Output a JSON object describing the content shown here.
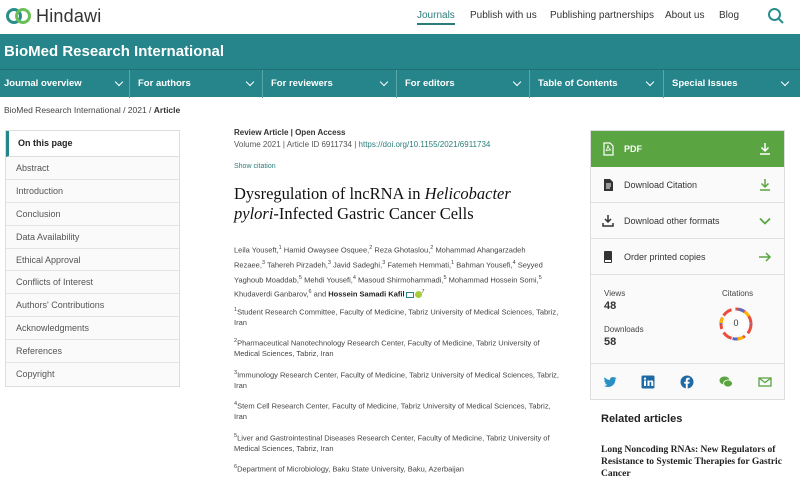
{
  "brand": {
    "name": "Hindawi"
  },
  "top_nav": [
    "Journals",
    "Publish with us",
    "Publishing partnerships",
    "About us",
    "Blog"
  ],
  "journal_title": "BioMed Research International",
  "sub_nav": [
    "Journal overview",
    "For authors",
    "For reviewers",
    "For editors",
    "Table of Contents",
    "Special Issues"
  ],
  "breadcrumb": {
    "path": "BioMed Research International / 2021 / ",
    "current": "Article"
  },
  "sidebar": {
    "heading": "On this page",
    "items": [
      "Abstract",
      "Introduction",
      "Conclusion",
      "Data Availability",
      "Ethical Approval",
      "Conflicts of Interest",
      "Authors' Contributions",
      "Acknowledgments",
      "References",
      "Copyright"
    ]
  },
  "article": {
    "type": "Review Article | Open Access",
    "meta": "Volume 2021 | Article ID 6911734 | ",
    "doi": "https://doi.org/10.1155/2021/6911734",
    "show_citation": "Show citation",
    "title_pre": "Dysregulation of lncRNA in ",
    "title_italic": "Helicobacter pylori",
    "title_post": "-Infected Gastric Cancer Cells",
    "authors": [
      {
        "name": "Leila Youseft,",
        "sup": "1"
      },
      {
        "name": " Hamid Owaysee Osquee,",
        "sup": "2"
      },
      {
        "name": " Reza Ghotaslou,",
        "sup": "2"
      },
      {
        "name": " Mohammad Ahangarzadeh Rezaee,",
        "sup": "3"
      },
      {
        "name": " Tahereh Pirzadeh,",
        "sup": "3"
      },
      {
        "name": " Javid Sadeghi,",
        "sup": "3"
      },
      {
        "name": " Fatemeh Hemmati,",
        "sup": "1"
      },
      {
        "name": " Bahman Yousefi,",
        "sup": "4"
      },
      {
        "name": " Seyyed Yaghoub Moaddab,",
        "sup": "5"
      },
      {
        "name": " Mehdi Yousefi,",
        "sup": "4"
      },
      {
        "name": " Masoud Shirmohammadi,",
        "sup": "5"
      },
      {
        "name": " Mohammad Hossein Somi,",
        "sup": "5"
      },
      {
        "name": " Khudaverdi Ganbarov,",
        "sup": "6"
      },
      {
        "name": " and ",
        "sup": ""
      }
    ],
    "corresponding_author": "Hossein Samadi Kafil",
    "corresponding_sup": "7",
    "affiliations": [
      {
        "sup": "1",
        "text": "Student Research Committee, Faculty of Medicine, Tabriz University of Medical Sciences, Tabriz, Iran"
      },
      {
        "sup": "2",
        "text": "Pharmaceutical Nanotechnology Research Center, Faculty of Medicine, Tabriz University of Medical Sciences, Tabriz, Iran"
      },
      {
        "sup": "3",
        "text": "Immunology Research Center, Faculty of Medicine, Tabriz University of Medical Sciences, Tabriz, Iran"
      },
      {
        "sup": "4",
        "text": "Stem Cell Research Center, Faculty of Medicine, Tabriz University of Medical Sciences, Tabriz, Iran"
      },
      {
        "sup": "5",
        "text": "Liver and Gastrointestinal Diseases Research Center, Faculty of Medicine, Tabriz University of Medical Sciences, Tabriz, Iran"
      },
      {
        "sup": "6",
        "text": "Department of Microbiology, Baku State University, Baku, Azerbaijan"
      }
    ]
  },
  "actions": {
    "pdf": "PDF",
    "download_citation": "Download Citation",
    "download_other": "Download other formats",
    "order_printed": "Order printed copies"
  },
  "metrics": {
    "views_label": "Views",
    "views": "48",
    "downloads_label": "Downloads",
    "downloads": "58",
    "citations_label": "Citations",
    "citations": "0"
  },
  "share_icons": [
    "twitter-icon",
    "linkedin-icon",
    "facebook-icon",
    "wechat-icon",
    "email-icon"
  ],
  "related": {
    "heading": "Related articles",
    "items": [
      "Long Noncoding RNAs: New Regulators of Resistance to Systemic Therapies for Gastric Cancer"
    ]
  },
  "colors": {
    "teal": "#26858a",
    "green": "#5aa542",
    "link": "#2a7d7a"
  }
}
